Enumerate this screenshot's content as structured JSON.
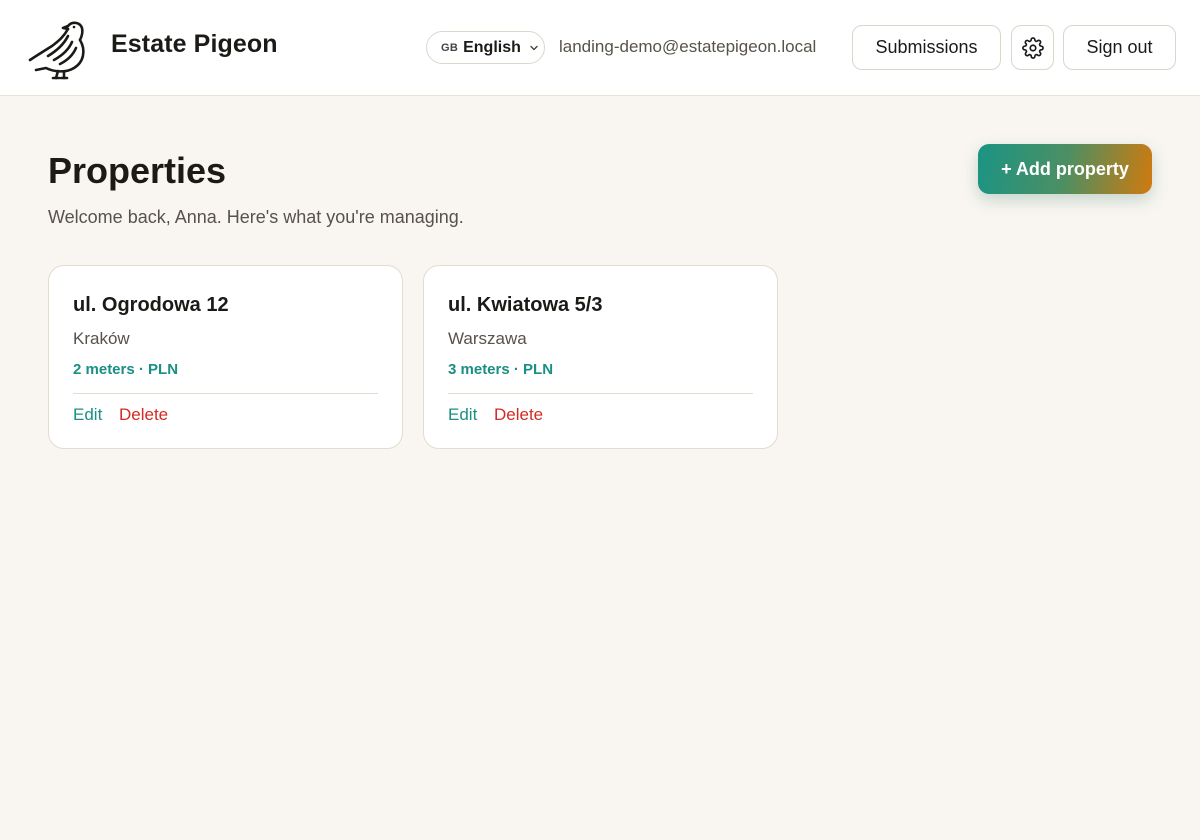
{
  "header": {
    "brand": "Estate Pigeon",
    "logo_icon": "pigeon-logo-icon",
    "language": {
      "flag": "GB",
      "label": "English",
      "icon": "chevron-down-icon"
    },
    "email": "landing-demo@estatepigeon.local",
    "submissions_label": "Submissions",
    "settings_icon": "gear-icon",
    "signout_label": "Sign out"
  },
  "main": {
    "title": "Properties",
    "subtitle": "Welcome back, Anna. Here's what you're managing.",
    "add_label": "+ Add property"
  },
  "properties": [
    {
      "name": "ul. Ogrodowa 12",
      "city": "Kraków",
      "meta": "2 meters · PLN",
      "edit_label": "Edit",
      "delete_label": "Delete"
    },
    {
      "name": "ul. Kwiatowa 5/3",
      "city": "Warszawa",
      "meta": "3 meters · PLN",
      "edit_label": "Edit",
      "delete_label": "Delete"
    }
  ],
  "colors": {
    "background": "#f9f6f1",
    "accent_teal": "#1a8f83",
    "danger": "#d42a25",
    "gradient_start": "#1a9484",
    "gradient_end": "#d07a0e"
  }
}
